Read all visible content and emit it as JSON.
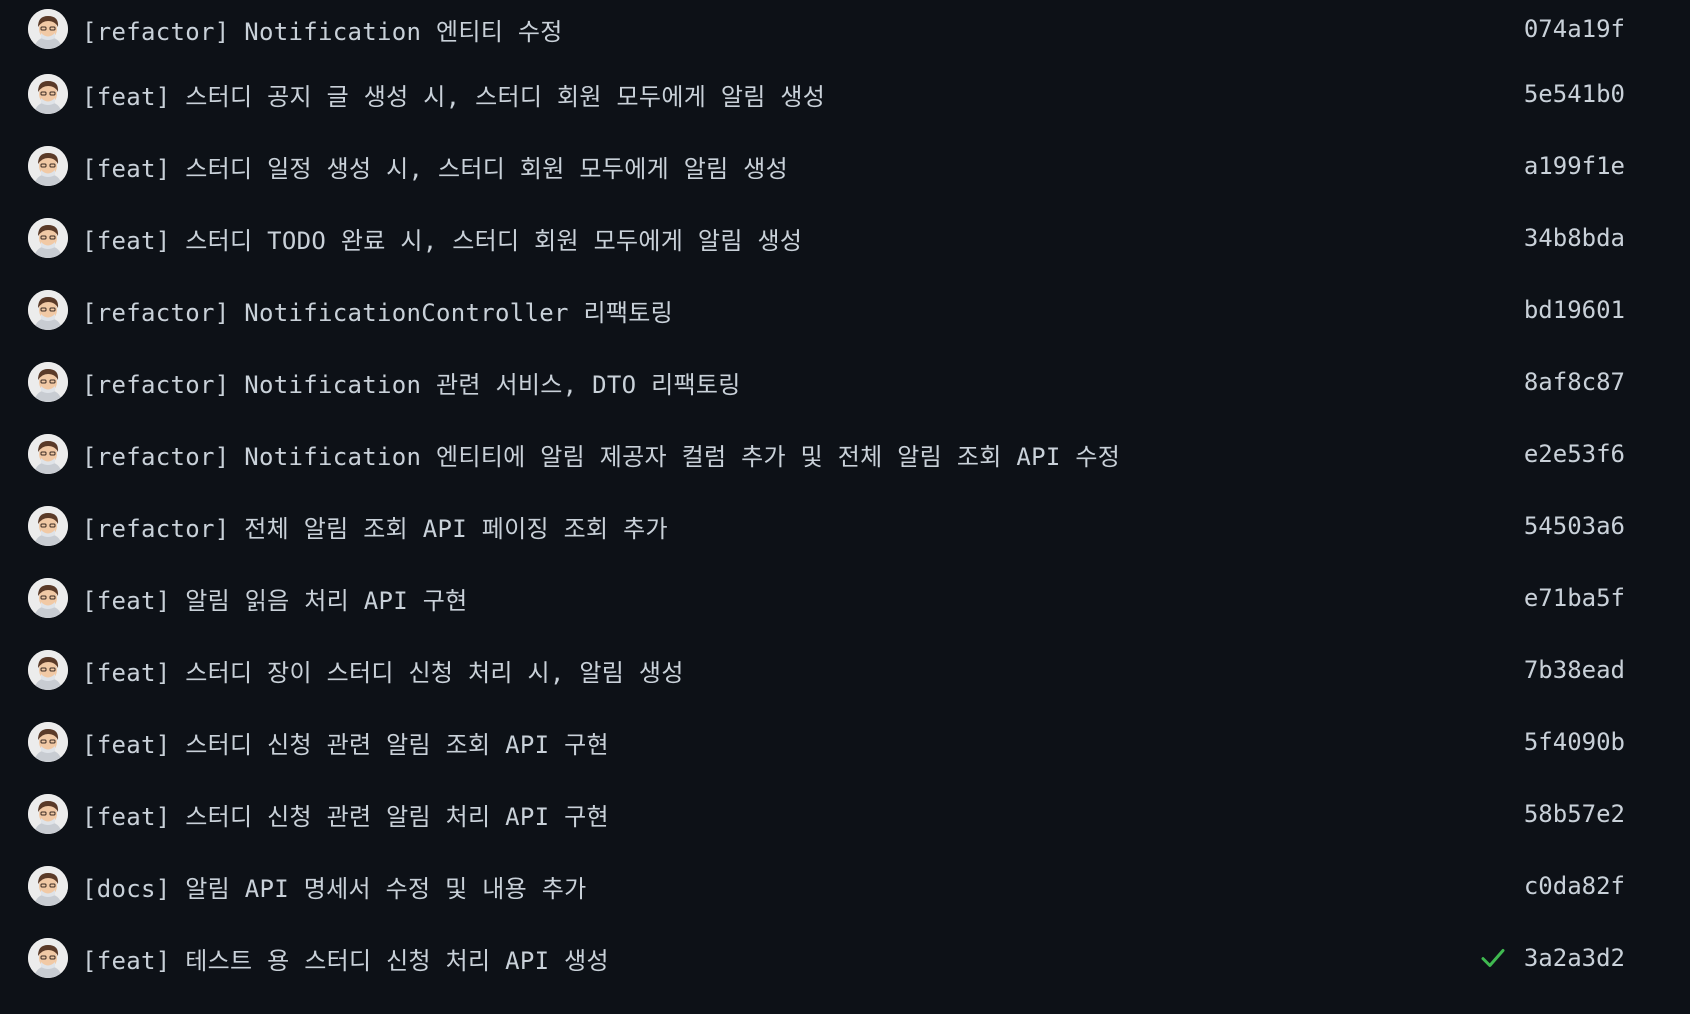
{
  "colors": {
    "background": "#0d1117",
    "text": "#c9d1d9",
    "success": "#3fb950"
  },
  "commits": [
    {
      "message": "[refactor] Notification 엔티티 수정",
      "sha": "074a19f"
    },
    {
      "message": "[feat] 스터디 공지 글 생성 시, 스터디 회원 모두에게 알림 생성",
      "sha": "5e541b0"
    },
    {
      "message": "[feat] 스터디 일정 생성 시, 스터디 회원 모두에게 알림 생성",
      "sha": "a199f1e"
    },
    {
      "message": "[feat] 스터디 TODO 완료 시, 스터디 회원 모두에게 알림 생성",
      "sha": "34b8bda"
    },
    {
      "message": "[refactor] NotificationController 리팩토링",
      "sha": "bd19601"
    },
    {
      "message": "[refactor] Notification 관련 서비스, DTO 리팩토링",
      "sha": "8af8c87"
    },
    {
      "message": "[refactor] Notification 엔티티에 알림 제공자 컬럼 추가 및 전체 알림 조회 API 수정",
      "sha": "e2e53f6"
    },
    {
      "message": "[refactor] 전체 알림 조회 API 페이징 조회 추가",
      "sha": "54503a6"
    },
    {
      "message": "[feat] 알림 읽음 처리 API 구현",
      "sha": "e71ba5f"
    },
    {
      "message": "[feat] 스터디 장이 스터디 신청 처리 시, 알림 생성",
      "sha": "7b38ead"
    },
    {
      "message": "[feat] 스터디 신청 관련 알림 조회 API 구현",
      "sha": "5f4090b"
    },
    {
      "message": "[feat] 스터디 신청 관련 알림 처리 API 구현",
      "sha": "58b57e2"
    },
    {
      "message": "[docs] 알림 API 명세서 수정 및 내용 추가",
      "sha": "c0da82f"
    },
    {
      "message": "[feat] 테스트 용 스터디 신청 처리 API 생성",
      "sha": "3a2a3d2",
      "status_icon": "check-icon"
    }
  ]
}
